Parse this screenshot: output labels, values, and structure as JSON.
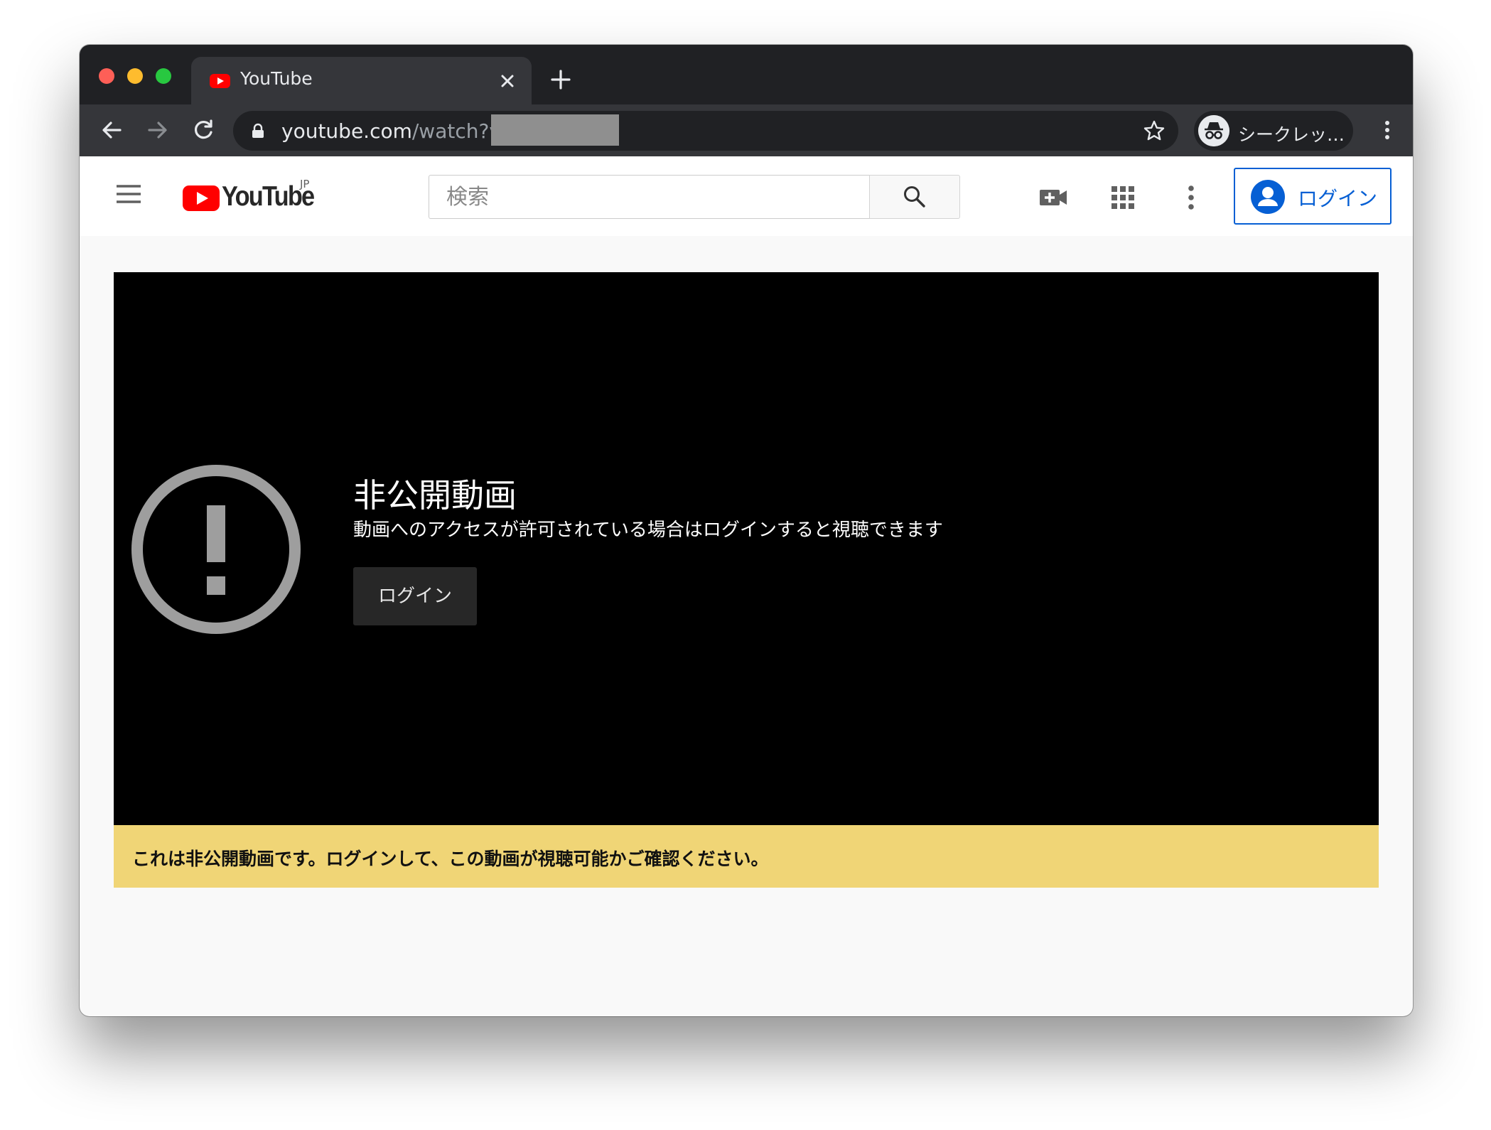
{
  "browser": {
    "tab": {
      "title": "YouTube",
      "favicon": "youtube-favicon-icon"
    },
    "address": {
      "host": "youtube.com",
      "path": "/watch?v="
    },
    "profile": {
      "label": "シークレッ…",
      "icon": "incognito-icon"
    }
  },
  "header": {
    "logo_text": "YouTube",
    "logo_region": "JP",
    "search_placeholder": "検索",
    "signin_label": "ログイン"
  },
  "player": {
    "error_title": "非公開動画",
    "error_subtitle": "動画へのアクセスが許可されている場合はログインすると視聴できます",
    "login_button": "ログイン"
  },
  "notice": {
    "text": "これは非公開動画です。ログインして、この動画が視聴可能かご確認ください。"
  },
  "colors": {
    "browser_frame": "#202124",
    "toolbar": "#35363a",
    "youtube_red": "#ff0000",
    "link_blue": "#065fd4",
    "notice_yellow": "#f0d576",
    "player_bg": "#000000"
  }
}
